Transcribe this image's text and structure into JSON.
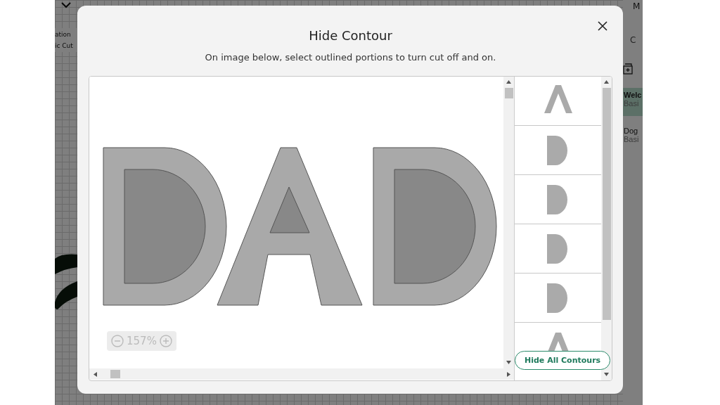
{
  "background": {
    "layer_items": [
      "ation",
      "ic Cut"
    ],
    "header_label": "M",
    "tab": "C",
    "projects": [
      {
        "title": "Welc",
        "subtitle": "Basi",
        "selected": true
      },
      {
        "title": "Dog",
        "subtitle": "Basi",
        "selected": false
      }
    ]
  },
  "dialog": {
    "title": "Hide Contour",
    "instructions": "On image below, select outlined portions to turn cut off and on.",
    "letters": [
      {
        "kind": "d"
      },
      {
        "kind": "a"
      },
      {
        "kind": "d"
      }
    ],
    "zoom": "157%",
    "contours": [
      {
        "kind": "a"
      },
      {
        "kind": "d"
      },
      {
        "kind": "d"
      },
      {
        "kind": "d"
      },
      {
        "kind": "d"
      },
      {
        "kind": "a"
      }
    ],
    "button": "Hide All Contours"
  }
}
